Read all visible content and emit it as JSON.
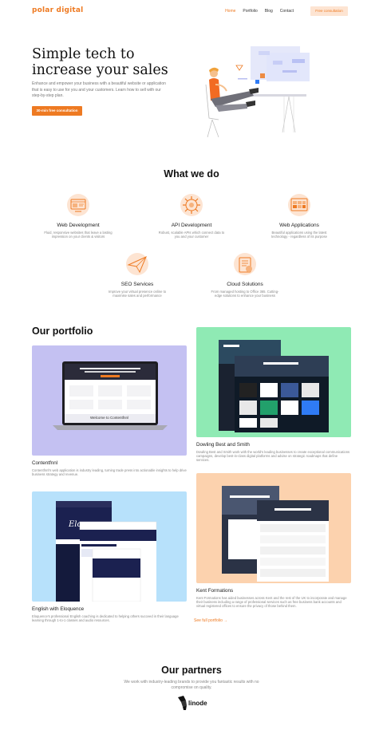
{
  "nav": {
    "logo": "polar digital",
    "links": [
      "Home",
      "Portfolio",
      "Blog",
      "Contact"
    ],
    "cta": "Free consultation"
  },
  "hero": {
    "title_line1": "Simple tech to",
    "title_line2": "increase your sales",
    "text": "Enhance and empower your business with a beautiful website or application that is easy to use for you and your customers. Learn how to sell with our step-by-step plan.",
    "button": "30-min free consultation"
  },
  "services": {
    "title": "What we do",
    "items": [
      {
        "title": "Web Development",
        "desc": "Fluid, responsive websites that leave a lasting impression on your clients & visitors",
        "icon": "web-development-icon"
      },
      {
        "title": "API Development",
        "desc": "Robust, scalable APIs which connect data to you and your customer",
        "icon": "api-development-icon"
      },
      {
        "title": "Web Applications",
        "desc": "Beautiful applications using the latest technology - regardless of its purpose",
        "icon": "web-applications-icon"
      },
      {
        "title": "SEO Services",
        "desc": "Improve your virtual presence online to maximise sales and performance",
        "icon": "seo-icon"
      },
      {
        "title": "Cloud Solutions",
        "desc": "From managed hosting to Office 365. Cutting-edge solutions to enhance your business",
        "icon": "cloud-solutions-icon"
      }
    ]
  },
  "portfolio": {
    "title": "Our portfolio",
    "items": [
      {
        "title": "Contentfnnl",
        "desc": "Contentfnnl's web application is industry leading, turning trade press into actionable insights to help drive business strategy and revenue.",
        "bg": "#c4c1f2",
        "laptop_caption": "Welcome to Contentfnnl"
      },
      {
        "title": "Dowling Best and Smith",
        "desc": "Dowling Best and Smith work with the world's leading businesses to create exceptional communications campaigns, develop best-in-class digital platforms and advise on strategic roadmaps that define services.",
        "bg": "#8feab4"
      },
      {
        "title": "English with Eloquence",
        "desc": "Eloquence's professional English coaching is dedicated to helping others succeed in their language learning through 1-to-1 classes and audio resources.",
        "bg": "#b7e1fb",
        "site_name": "Eloquence"
      },
      {
        "title": "Kent Formations",
        "desc": "Kent Formations has aided businesses across Kent and the rest of the UK to incorporate and manage their business including a range of professional services such as free business bank accounts and virtual registered offices to ensure the privacy of those behind them.",
        "bg": "#fcd2ae"
      }
    ],
    "see_full": "See full portfolio →"
  },
  "partners": {
    "title": "Our partners",
    "text": "We work with industry-leading brands to provide you fantastic results with no compromise on quality.",
    "logo_label": "linode"
  },
  "colors": {
    "accent": "#ee7a22",
    "accent_light": "#fde4d2"
  }
}
